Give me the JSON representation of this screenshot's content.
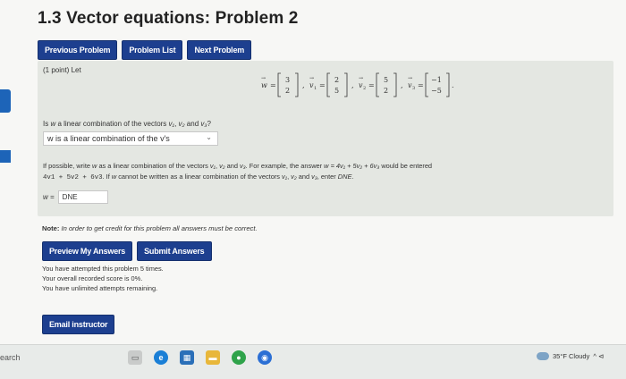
{
  "page": {
    "title": "1.3 Vector equations: Problem 2",
    "nav": {
      "previous": "Previous Problem",
      "list": "Problem List",
      "next": "Next Problem"
    }
  },
  "problem": {
    "points": "(1 point) Let",
    "equation": {
      "w": [
        "3",
        "2"
      ],
      "v1": [
        "2",
        "5"
      ],
      "v2": [
        "5",
        "2"
      ],
      "v3": [
        "−1",
        "−5"
      ]
    },
    "question": "Is w a linear combination of the vectors v1, v2 and v3?",
    "question_parts": {
      "p1": "Is ",
      "w": "w",
      "p2": " a linear combination of the vectors ",
      "v1": "v₁",
      "comma": ", ",
      "v2": "v₂",
      "and": " and ",
      "v3": "v₃",
      "q": "?"
    },
    "dropdown_value": "w is a linear combination of the v's",
    "instructions": {
      "line1a": "If possible, write ",
      "w": "w",
      "line1b": " as a linear combination of the vectors ",
      "v1": "v₁",
      "comma": ", ",
      "v2": "v₂",
      "and": " and ",
      "v3": "v₃",
      "line1c": ". For example, the answer ",
      "example": "w = 4v₁ + 5v₂ + 6v₃",
      "line1d": " would be entered",
      "code": "4v1 + 5v2 + 6v3",
      "line2a": ". If ",
      "line2b": " cannot be written as a linear combination of the vectors ",
      "line2c": ", enter ",
      "dne": "DNE",
      "period": "."
    },
    "answer_label": "w =",
    "answer_value": "DNE"
  },
  "note": {
    "bold": "Note:",
    "text": " In order to get credit for this problem all answers must be correct."
  },
  "answer_buttons": {
    "preview": "Preview My Answers",
    "submit": "Submit Answers"
  },
  "status": {
    "attempted": "You have attempted this problem 5 times.",
    "score": "Your overall recorded score is 0%.",
    "remaining": "You have unlimited attempts remaining."
  },
  "email_button": "Email instructor",
  "taskbar": {
    "search": "earch",
    "weather": "35°F  Cloudy",
    "tray": "^ ⊲"
  },
  "colors": {
    "button_blue": "#1d3f8f",
    "problem_bg": "#e4e7e2"
  }
}
